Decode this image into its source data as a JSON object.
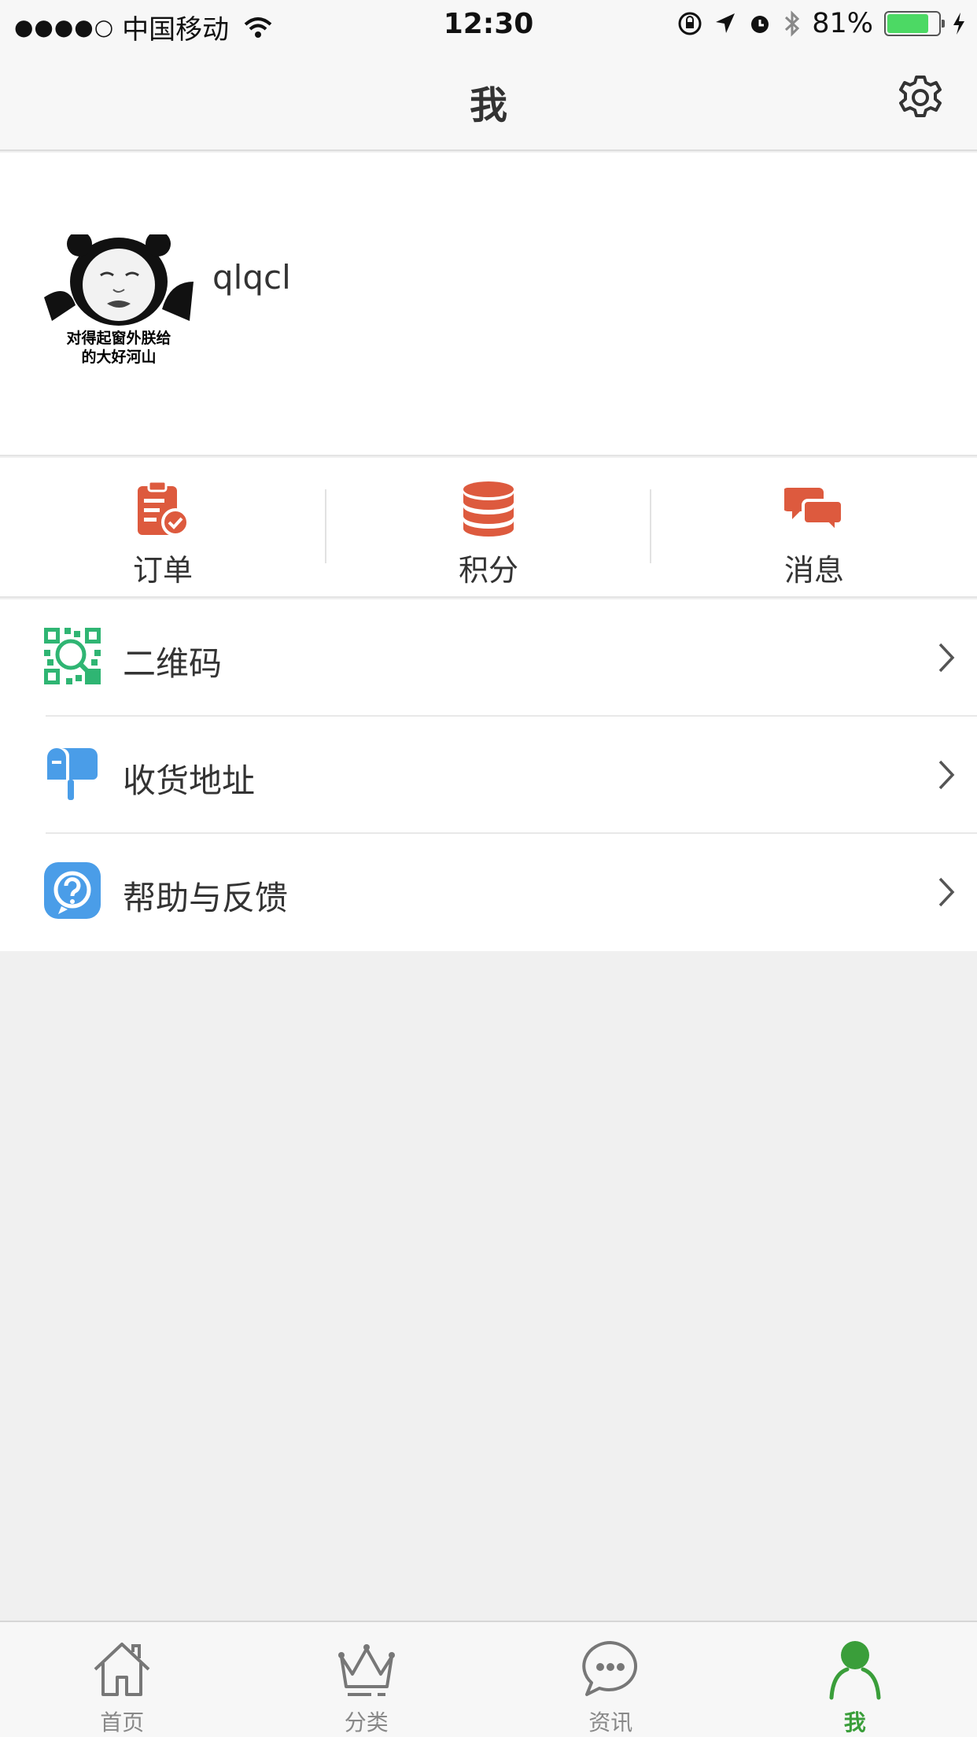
{
  "status_bar": {
    "signal": "●●●●○",
    "carrier": "中国移动",
    "time": "12:30",
    "battery": "81%",
    "battery_level": 0.81
  },
  "nav": {
    "title": "我",
    "settings_icon": "gear-icon"
  },
  "profile": {
    "avatar_caption_line1": "对得起窗外朕给",
    "avatar_caption_line2": "的大好河山",
    "username": "qlqcl"
  },
  "shortcuts": [
    {
      "label": "订单",
      "icon": "order-clipboard-icon"
    },
    {
      "label": "积分",
      "icon": "points-coins-icon"
    },
    {
      "label": "消息",
      "icon": "message-chat-icon"
    }
  ],
  "menu": [
    {
      "label": "二维码",
      "icon": "qr-code-icon"
    },
    {
      "label": "收货地址",
      "icon": "mailbox-icon"
    },
    {
      "label": "帮助与反馈",
      "icon": "help-icon"
    }
  ],
  "tabs": [
    {
      "label": "首页",
      "icon": "home-icon"
    },
    {
      "label": "分类",
      "icon": "crown-icon"
    },
    {
      "label": "资讯",
      "icon": "chat-bubble-icon"
    },
    {
      "label": "我",
      "icon": "person-icon",
      "active": true
    }
  ],
  "colors": {
    "accent_green": "#3a9e3a",
    "icon_orange": "#dd5a3e",
    "qr_green": "#2fb573",
    "icon_blue": "#4a9de8"
  }
}
